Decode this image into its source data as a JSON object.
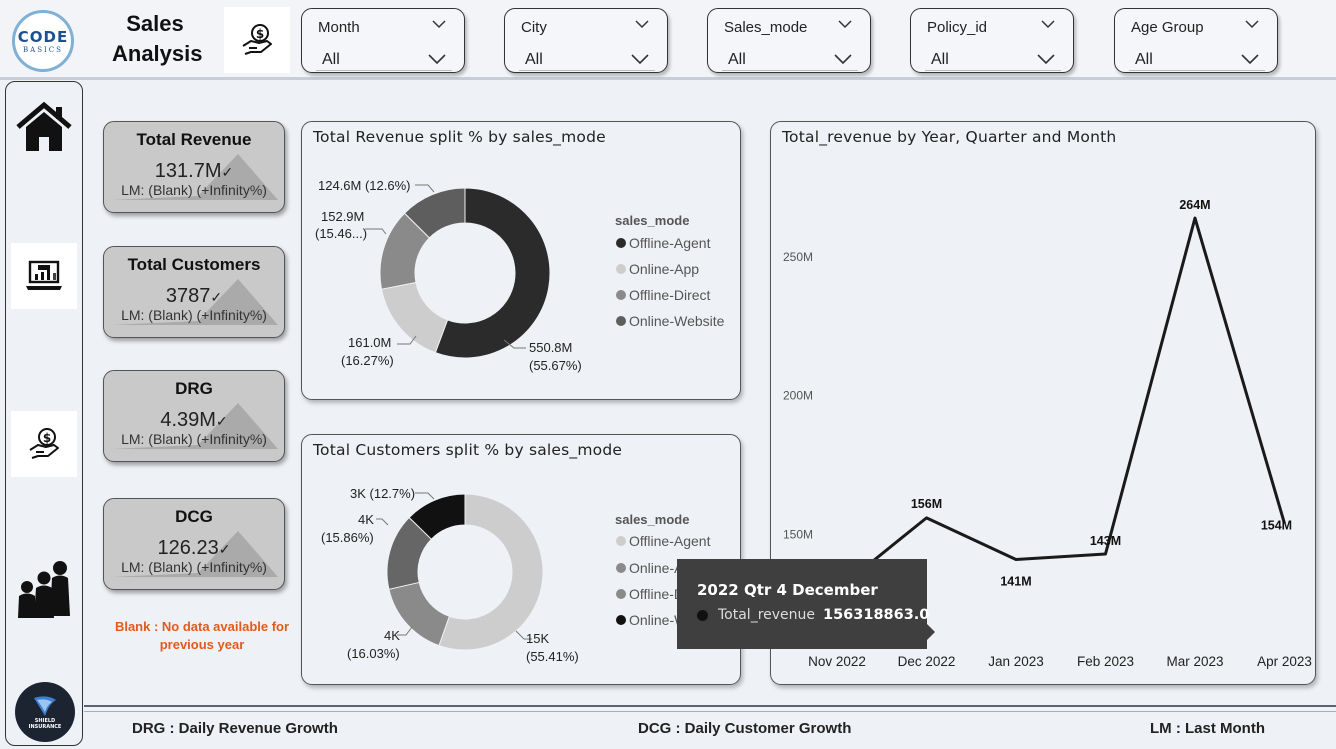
{
  "header": {
    "logo_line1": "CODE",
    "logo_line2": "BASICS",
    "title_line1": "Sales",
    "title_line2": "Analysis",
    "title_icon": "money-hand-icon"
  },
  "slicers": [
    {
      "label": "Month",
      "value": "All"
    },
    {
      "label": "City",
      "value": "All"
    },
    {
      "label": "Sales_mode",
      "value": "All"
    },
    {
      "label": "Policy_id",
      "value": "All"
    },
    {
      "label": "Age Group",
      "value": "All"
    }
  ],
  "sidebar": {
    "items": [
      {
        "icon": "home-icon"
      },
      {
        "icon": "kpi-laptop-icon"
      },
      {
        "icon": "money-hand-icon"
      },
      {
        "icon": "family-icon"
      }
    ],
    "brand_logo_line1": "SHIELD",
    "brand_logo_line2": "INSURANCE"
  },
  "kpis": [
    {
      "title": "Total Revenue",
      "value": "131.7M",
      "sub": "LM: (Blank) (+Infinity%)"
    },
    {
      "title": "Total Customers",
      "value": "3787",
      "sub": "LM: (Blank) (+Infinity%)"
    },
    {
      "title": "DRG",
      "value": "4.39M",
      "sub": "LM: (Blank) (+Infinity%)"
    },
    {
      "title": "DCG",
      "value": "126.23",
      "sub": "LM: (Blank) (+Infinity%)"
    }
  ],
  "blank_note": {
    "line1": "Blank : No data available for",
    "line2": "previous year"
  },
  "revenue_split": {
    "title": "Total Revenue split % by sales_mode",
    "legend_title": "sales_mode",
    "slices": [
      {
        "name": "Offline-Agent",
        "value": 550.8,
        "label1": "550.8M",
        "label2": "(55.67%)",
        "color": "#2b2b2b"
      },
      {
        "name": "Online-App",
        "value": 161.0,
        "label1": "161.0M",
        "label2": "(16.27%)",
        "color": "#cdcdcd"
      },
      {
        "name": "Offline-Direct",
        "value": 152.9,
        "label1": "152.9M",
        "label2": "(15.46...)",
        "color": "#8a8a8a"
      },
      {
        "name": "Online-Website",
        "value": 124.6,
        "label1": "124.6M (12.6%)",
        "label2": "",
        "color": "#5e5e5e"
      }
    ]
  },
  "customer_split": {
    "title": "Total Customers split % by sales_mode",
    "legend_title": "sales_mode",
    "legend": [
      {
        "name": "Offline-Agent",
        "color": "#cdcdcd"
      },
      {
        "name": "Online-App",
        "color": "#8a8a8a"
      },
      {
        "name": "Offline-Direct",
        "color": "#8a8a8a"
      },
      {
        "name": "Online-Website",
        "color": "#111111"
      }
    ],
    "slices": [
      {
        "name": "Offline-Agent",
        "value": 55.41,
        "label1": "15K",
        "label2": "(55.41%)",
        "color": "#cdcdcd"
      },
      {
        "name": "Online-App",
        "value": 16.03,
        "label1": "4K",
        "label2": "(16.03%)",
        "color": "#8a8a8a"
      },
      {
        "name": "Offline-Direct",
        "value": 15.86,
        "label1": "4K",
        "label2": "(15.86%)",
        "color": "#666666"
      },
      {
        "name": "Online-Website",
        "value": 12.7,
        "label1": "3K (12.7%)",
        "label2": "",
        "color": "#111111"
      }
    ]
  },
  "chart_data": {
    "type": "line",
    "title": "Total_revenue by Year, Quarter and Month",
    "categories": [
      "Nov 2022",
      "Dec 2022",
      "Jan 2023",
      "Feb 2023",
      "Mar 2023",
      "Apr 2023"
    ],
    "values": [
      130,
      156,
      141,
      143,
      264,
      154
    ],
    "data_labels": [
      "",
      "156M",
      "141M",
      "143M",
      "264M",
      "154M"
    ],
    "y_ticks": [
      {
        "value": 150,
        "label": "150M"
      },
      {
        "value": 200,
        "label": "200M"
      },
      {
        "value": 250,
        "label": "250M"
      }
    ],
    "ylim": [
      112,
      277
    ],
    "grid": false,
    "line_color": "#1a1a1a"
  },
  "tooltip": {
    "header": "2022 Qtr 4 December",
    "label": "Total_revenue",
    "value": "156318863.0"
  },
  "footer": {
    "drg": "DRG : Daily Revenue Growth",
    "dcg": "DCG : Daily Customer Growth",
    "lm": "LM : Last Month"
  }
}
